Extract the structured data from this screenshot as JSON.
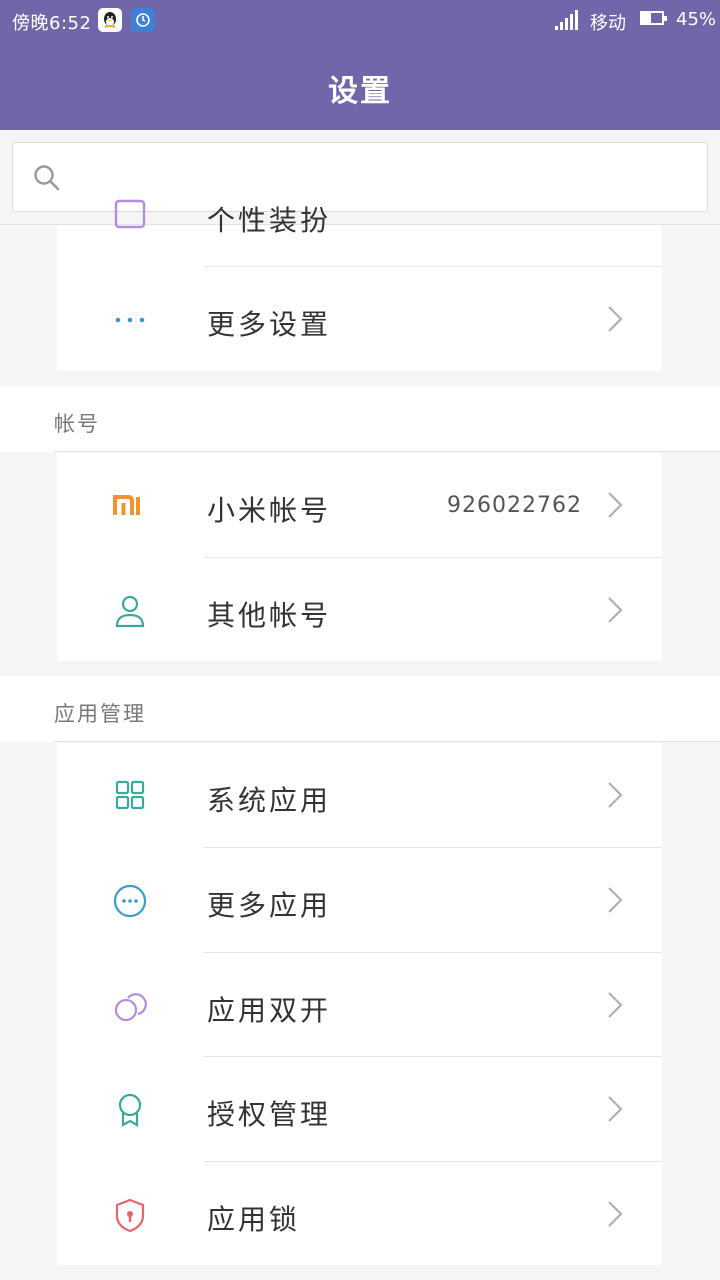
{
  "status_bar": {
    "time": "傍晚6:52",
    "carrier": "移动",
    "battery": "45%",
    "battery_level": 0.45
  },
  "header": {
    "title": "设置"
  },
  "search": {
    "placeholder": ""
  },
  "top_card": {
    "partial_item": {
      "label": "个性装扮"
    },
    "more_settings": {
      "label": "更多设置",
      "icon": "more-dots-icon"
    }
  },
  "accounts": {
    "title": "帐号",
    "items": [
      {
        "label": "小米帐号",
        "value": "926022762",
        "icon": "mi-logo-icon",
        "color": "#f0952e"
      },
      {
        "label": "其他帐号",
        "value": "",
        "icon": "person-icon",
        "color": "#3aa89a"
      }
    ]
  },
  "app_management": {
    "title": "应用管理",
    "items": [
      {
        "label": "系统应用",
        "icon": "grid-icon",
        "color": "#3aa89a"
      },
      {
        "label": "更多应用",
        "icon": "more-circle-icon",
        "color": "#3a9cc7"
      },
      {
        "label": "应用双开",
        "icon": "dual-circle-icon",
        "color": "#b58de0"
      },
      {
        "label": "授权管理",
        "icon": "badge-icon",
        "color": "#3aa89a"
      },
      {
        "label": "应用锁",
        "icon": "shield-lock-icon",
        "color": "#e0666b"
      }
    ]
  },
  "colors": {
    "header": "#7067aa",
    "background": "#f5f5f5"
  }
}
